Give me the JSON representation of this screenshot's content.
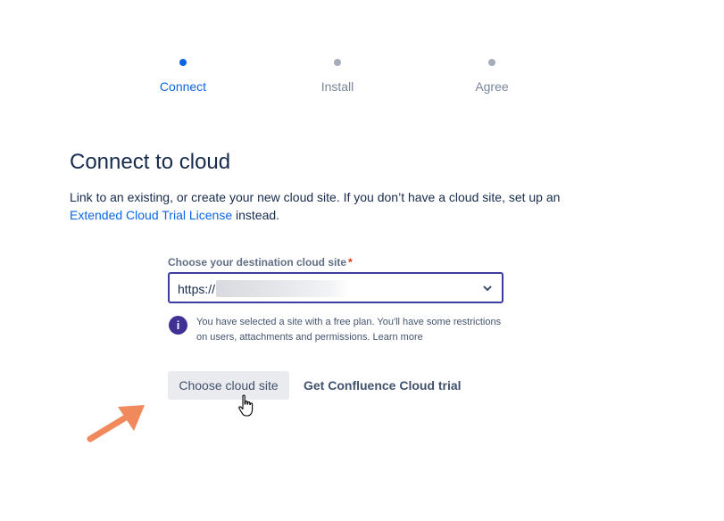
{
  "stepper": {
    "steps": [
      {
        "label": "Connect",
        "active": true
      },
      {
        "label": "Install",
        "active": false
      },
      {
        "label": "Agree",
        "active": false
      }
    ]
  },
  "main": {
    "title": "Connect to cloud",
    "description_text": "Link to an existing, or create your new cloud site. If you don’t have a cloud site, set up an ",
    "description_link": "Extended Cloud Trial License",
    "description_suffix": " instead."
  },
  "field": {
    "label": "Choose your destination cloud site",
    "required_mark": "*",
    "value": "https://",
    "dropdown_icon": "chevron-down-icon"
  },
  "info": {
    "icon": "info-icon",
    "icon_glyph": "i",
    "text": "You have selected a site with a free plan. You'll have some restrictions on users, attachments and permissions. Learn more"
  },
  "buttons": {
    "choose": "Choose cloud site",
    "trial": "Get Confluence Cloud trial"
  },
  "colors": {
    "accent": "#0c66e4",
    "select_border": "#3b3d9f",
    "info_icon": "#403294",
    "annotation_arrow": "#f08a5d"
  }
}
